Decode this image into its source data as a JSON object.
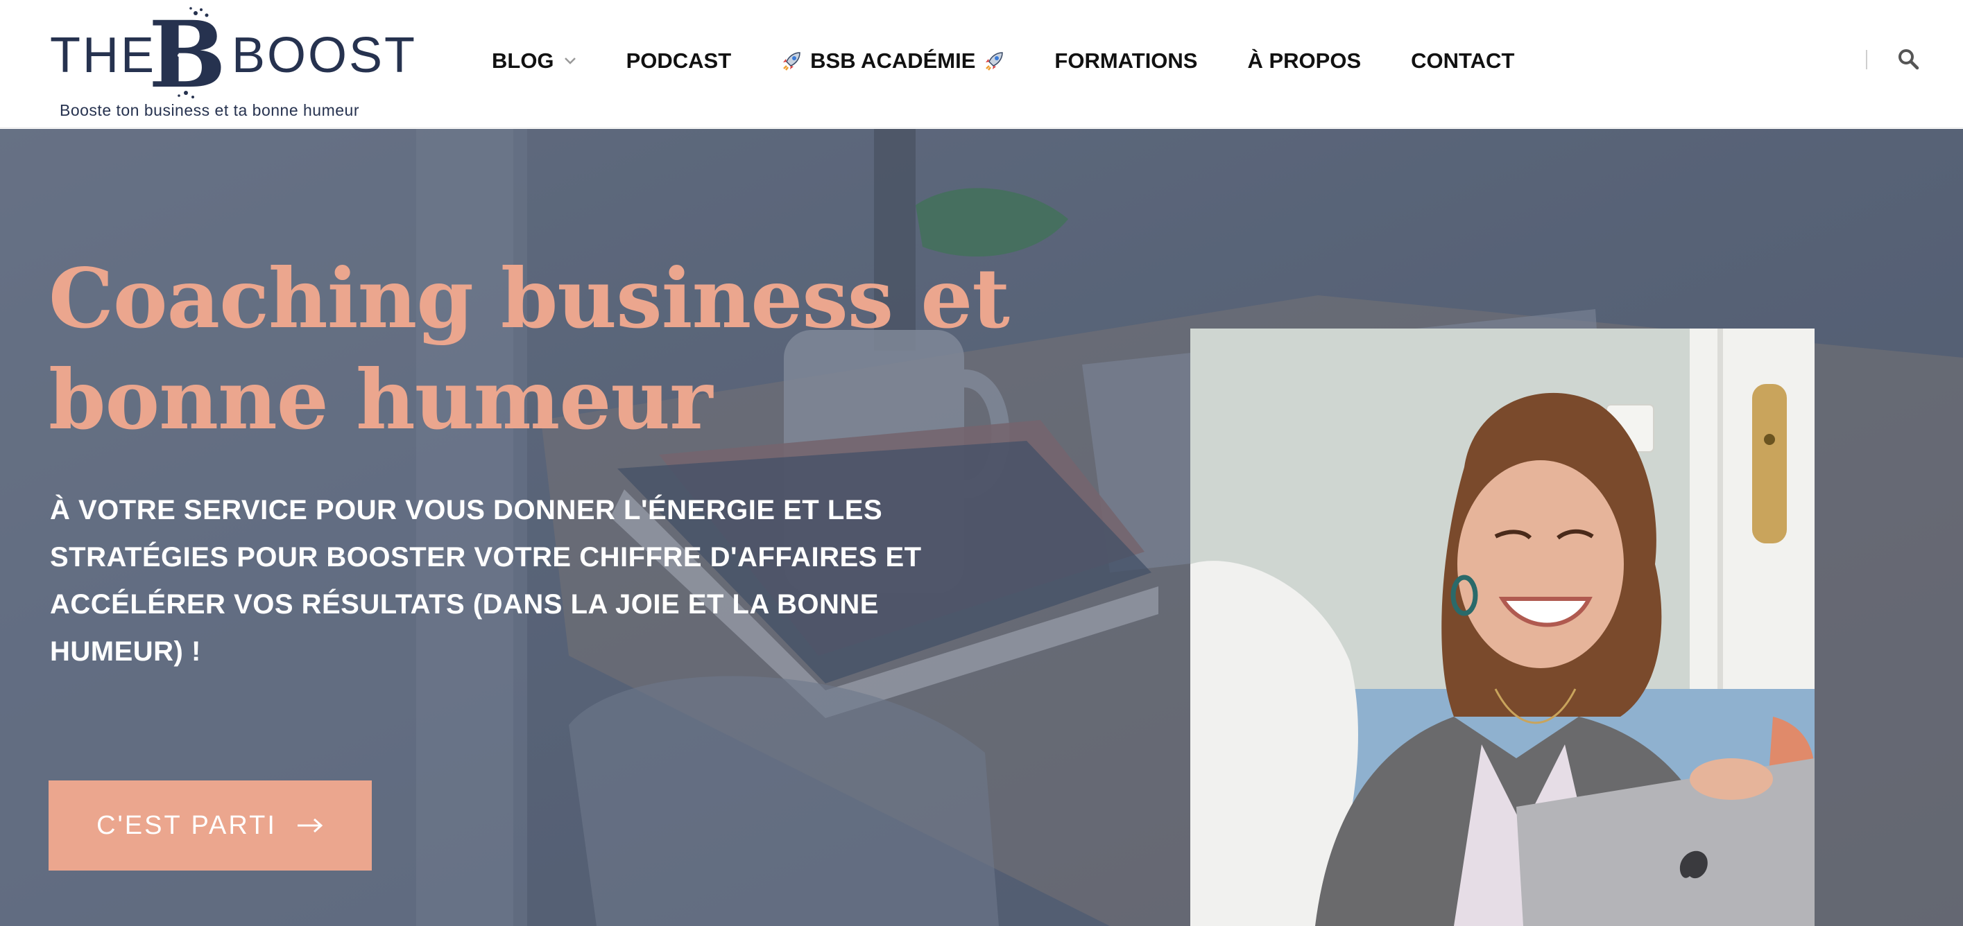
{
  "header": {
    "logo": {
      "word_left": "THE",
      "word_middle": "B",
      "word_right": "BOOST",
      "tagline": "Booste ton business et ta bonne humeur"
    },
    "nav": [
      {
        "label": "BLOG",
        "has_dropdown": true
      },
      {
        "label": "PODCAST"
      },
      {
        "label": "BSB ACADÉMIE",
        "icon": "rocket-icon"
      },
      {
        "label": "FORMATIONS"
      },
      {
        "label": "À PROPOS"
      },
      {
        "label": "CONTACT"
      }
    ],
    "search_icon": "search-icon"
  },
  "hero": {
    "title": "Coaching business et bonne humeur",
    "subtitle": "À VOTRE SERVICE POUR VOUS DONNER L'ÉNERGIE ET LES STRATÉGIES POUR BOOSTER VOTRE CHIFFRE D'AFFAIRES ET ACCÉLÉRER VOS RÉSULTATS (DANS LA JOIE ET LA BONNE HUMEUR) !",
    "cta_label": "C'EST PARTI"
  },
  "colors": {
    "brand_navy": "#26324f",
    "accent_peach": "#eba68e",
    "hero_overlay": "#5a6578",
    "nav_text": "#111111"
  }
}
